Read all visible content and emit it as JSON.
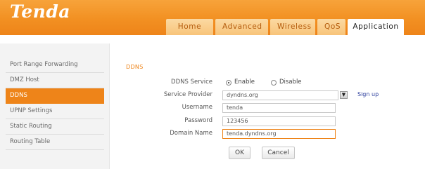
{
  "brand": {
    "logo": "Tenda"
  },
  "tabs": [
    {
      "label": "Home"
    },
    {
      "label": "Advanced"
    },
    {
      "label": "Wireless"
    },
    {
      "label": "QoS"
    },
    {
      "label": "Application"
    }
  ],
  "sidebar": {
    "items": [
      {
        "label": "Port Range Forwarding"
      },
      {
        "label": "DMZ Host"
      },
      {
        "label": "DDNS",
        "active": true
      },
      {
        "label": "UPNP Settings"
      },
      {
        "label": "Static Routing"
      },
      {
        "label": "Routing Table"
      }
    ]
  },
  "section": {
    "title": "DDNS"
  },
  "form": {
    "service": {
      "label": "DDNS Service",
      "enable": "Enable",
      "disable": "Disable",
      "selected": "Enable"
    },
    "provider": {
      "label": "Service Provider",
      "value": "dyndns.org",
      "signup": "Sign up"
    },
    "username": {
      "label": "Username",
      "value": "tenda"
    },
    "password": {
      "label": "Password",
      "value": "123456"
    },
    "domain": {
      "label": "Domain Name",
      "value": "tenda.dyndns.org"
    }
  },
  "buttons": {
    "ok": "OK",
    "cancel": "Cancel"
  },
  "colors": {
    "accent": "#ee8419",
    "link": "#2a3c9c"
  }
}
